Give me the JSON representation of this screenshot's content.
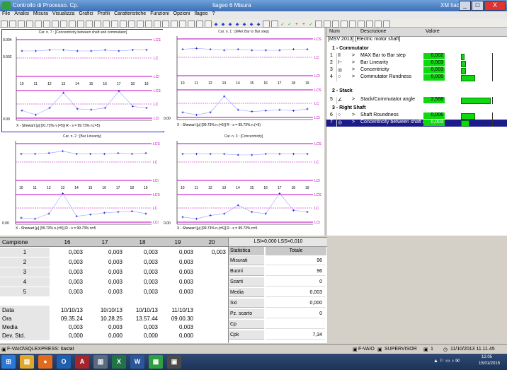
{
  "window": {
    "app_title": "Controllo di Processo. Cp.",
    "center_title": "Ilageo 6 Misura",
    "user": "XM ltaca",
    "min": "_",
    "max": "□",
    "close": "X"
  },
  "menu": [
    "File",
    "Analisi",
    "Misura",
    "Visualizza",
    "Grafici",
    "Profili",
    "Caratteristiche",
    "Funzioni",
    "Opzioni",
    "Ilageo",
    "?"
  ],
  "toolbar": {
    "icons": [
      "open-icon",
      "save-icon",
      "print-icon",
      "copy-icon",
      "paste-icon",
      "chart-icon",
      "table-icon",
      "grid-icon",
      "list-icon",
      "histogram-icon",
      "bars-icon",
      "calc-icon",
      "filter-icon",
      "zoom-icon",
      "settings-icon",
      "export-icon",
      "import-icon",
      "report-icon",
      "stats-icon",
      "sigma-icon",
      "db-icon",
      "lock-icon",
      "user-icon",
      "help-icon",
      "refresh-icon",
      "first-icon",
      "prev-icon",
      "play-icon",
      "next-icon",
      "last-icon",
      "rewind-icon",
      "forward-icon",
      "stop-icon",
      "record-icon",
      "check-icon",
      "check2-icon",
      "plus-icon",
      "minus-icon",
      "ok-icon",
      "cancel-icon",
      "warn-icon",
      "info-icon",
      "find-icon",
      "home-icon",
      "pin-icon",
      "tool-icon",
      "window-icon",
      "exit-icon"
    ]
  },
  "charts": [
    {
      "title": "Car. n. 7 : [Concentricity between shaft and commutator]",
      "y_top_labels": [
        "0.004",
        "0.002"
      ],
      "y_bottom_label": "0.00",
      "x_labels": [
        "10",
        "11",
        "12",
        "13",
        "14",
        "15",
        "16",
        "17",
        "18",
        "19"
      ],
      "limit_labels": [
        "LCS",
        "LC",
        "LCI"
      ],
      "legend": "X - Shewart [μ] [91.73% n.(=5)] R - s = 99.73% n.(=5)"
    },
    {
      "title": "Car. n. 1 : [MAX Bar to Bar step]",
      "y_top_labels": [],
      "y_bottom_label": "0.00",
      "x_labels": [
        "10",
        "11",
        "12",
        "13",
        "14",
        "15",
        "16",
        "17",
        "18",
        "19"
      ],
      "limit_labels": [
        "LCS",
        "LC",
        "LCI"
      ],
      "legend": "X - Shewart [μ] [99.73% n.(=5)] R - s = 99.73% n.(=5)"
    },
    {
      "title": "Car. n. 2 : [Bar Linearity]",
      "y_top_labels": [],
      "y_bottom_label": "0.00",
      "x_labels": [
        "10",
        "11",
        "12",
        "13",
        "14",
        "15",
        "16",
        "17",
        "18",
        "19"
      ],
      "limit_labels": [
        "LCS",
        "LC",
        "LCI"
      ],
      "legend": "X - Shewart [μ] [99.73% n.(=5)] R - s = 99.73% n=5"
    },
    {
      "title": "Car. n. 3 : [Concentricity]",
      "y_top_labels": [],
      "y_bottom_label": "0.00",
      "x_labels": [
        "10",
        "11",
        "12",
        "13",
        "14",
        "15",
        "16",
        "17",
        "18",
        "19"
      ],
      "limit_labels": [
        "LCS",
        "LC",
        "LCI"
      ],
      "legend": "X - Shewart [μ] [99.73% n.(=5)] R - s = 99.73% n=5"
    }
  ],
  "chart_data": [
    {
      "type": "line",
      "title": "Car. n. 7 : [Concentricity between shaft and commutator]",
      "x": [
        10,
        11,
        12,
        13,
        14,
        15,
        16,
        17,
        18,
        19
      ],
      "series": [
        {
          "values": [
            0.003,
            0.003,
            0.0031,
            0.0031,
            0.003,
            0.003,
            0.0031,
            0.003,
            0.0031,
            0.0031
          ]
        }
      ],
      "ylim": [
        0,
        0.0045
      ]
    },
    {
      "type": "line",
      "title": "Car. n. 1 : [MAX Bar to Bar step]",
      "x": [
        10,
        11,
        12,
        13,
        14,
        15,
        16,
        17,
        18,
        19
      ],
      "series": [
        {
          "values": [
            0.0031,
            0.0032,
            0.0031,
            0.003,
            0.0031,
            0.003,
            0.003,
            0.003,
            0.0031,
            0.0031
          ]
        }
      ],
      "ylim": [
        0,
        0.0045
      ]
    },
    {
      "type": "line",
      "title": "Car. n. 2 : [Bar Linearity]",
      "x": [
        10,
        11,
        12,
        13,
        14,
        15,
        16,
        17,
        18,
        19
      ],
      "series": [
        {
          "values": [
            0.0031,
            0.0031,
            0.0032,
            0.0034,
            0.0031,
            0.0031,
            0.0031,
            0.0032,
            0.0031,
            0.0032
          ]
        }
      ],
      "ylim": [
        0,
        0.0045
      ]
    },
    {
      "type": "line",
      "title": "Car. n. 3 : [Concentricity]",
      "x": [
        10,
        11,
        12,
        13,
        14,
        15,
        16,
        17,
        18,
        19
      ],
      "series": [
        {
          "values": [
            0.0031,
            0.0031,
            0.0031,
            0.0031,
            0.003,
            0.003,
            0.0031,
            0.0031,
            0.0031,
            0.0031
          ]
        }
      ],
      "ylim": [
        0,
        0.0045
      ]
    }
  ],
  "right_panel": {
    "headers": {
      "num": "Num",
      "desc": "Descrizione",
      "value": "Valore"
    },
    "part": "[MSV 2013] [Electric motor shaft]",
    "groups": [
      {
        "label": "1 - Commutator"
      },
      {
        "label": "2 - Stack"
      },
      {
        "label": "3 - Right Shaft"
      }
    ],
    "rows": [
      {
        "num": "1",
        "icon": "II",
        "arrow": ">",
        "desc": "MAX Bar to Bar step",
        "value": "0,002",
        "bar": 0.08
      },
      {
        "num": "2",
        "icon": "I~",
        "arrow": ">",
        "desc": "Bar Linearity",
        "value": "0,003",
        "bar": 0.12
      },
      {
        "num": "3",
        "icon": "◎",
        "arrow": ">",
        "desc": "Concentricity",
        "value": "0,003",
        "bar": 0.12
      },
      {
        "num": "4",
        "icon": "○",
        "arrow": ">",
        "desc": "Commutator Rundness",
        "value": "0,005",
        "bar": 0.45
      },
      {
        "num": "5",
        "icon": "∠",
        "arrow": ">",
        "desc": "Stack/Commutator angle",
        "value": "2,568",
        "bar": 1.0
      },
      {
        "num": "6",
        "icon": "○",
        "arrow": ">",
        "desc": "Shaft Roundness",
        "value": "0,006",
        "bar": 0.45
      },
      {
        "num": "7",
        "icon": "◎",
        "arrow": ">",
        "desc": "Concentricity between shaft a",
        "value": "0,003",
        "bar": 0.25
      }
    ]
  },
  "table": {
    "corner": "Campione",
    "columns": [
      "16",
      "17",
      "18",
      "19",
      "20"
    ],
    "rows": [
      {
        "label": "1",
        "values": [
          "0,003",
          "0,003",
          "0,003",
          "0,003",
          "0,003"
        ]
      },
      {
        "label": "2",
        "values": [
          "0,003",
          "0,003",
          "0,003",
          "0,003",
          ""
        ]
      },
      {
        "label": "3",
        "values": [
          "0,003",
          "0,003",
          "0,003",
          "0,003",
          ""
        ]
      },
      {
        "label": "4",
        "values": [
          "0,003",
          "0,003",
          "0,003",
          "0,003",
          ""
        ]
      },
      {
        "label": "5",
        "values": [
          "0,003",
          "0,003",
          "0,003",
          "0,003",
          ""
        ]
      }
    ],
    "info": [
      {
        "label": "Data",
        "values": [
          "10/10/13",
          "10/10/13",
          "10/10/13",
          "11/10/13",
          ""
        ]
      },
      {
        "label": "Ora",
        "values": [
          "09.35.24",
          "10.28.25",
          "13.57.44",
          "09.00.30",
          ""
        ]
      },
      {
        "label": "Media",
        "values": [
          "0,003",
          "0,003",
          "0,003",
          "0,003",
          ""
        ]
      },
      {
        "label": "Dev. Std.",
        "values": [
          "0,000",
          "0,000",
          "0,000",
          "0,000",
          ""
        ]
      }
    ]
  },
  "stats": {
    "limits": "LSI=0,000    LSS=0,010",
    "col_label": "Statistica",
    "col_total": "Totale",
    "rows": [
      {
        "label": "Misurati",
        "value": "96"
      },
      {
        "label": "Buoni",
        "value": "96"
      },
      {
        "label": "Scarti",
        "value": "0"
      },
      {
        "label": "Media",
        "value": "0,003"
      },
      {
        "label": "Sxi",
        "value": "0,000"
      },
      {
        "label": "Pz. scarto",
        "value": "0"
      },
      {
        "label": "Cp",
        "value": ""
      },
      {
        "label": "Cpk",
        "value": "7,34"
      }
    ]
  },
  "status": {
    "db": "F-VAIO\\SQLEXPRESS: itastat",
    "host": "F-VAIO",
    "role": "SUPERVISOR",
    "count": "1",
    "datetime": "11/10/2013 11.11.45"
  },
  "taskbar": {
    "time": "12.05",
    "date": "15/01/2015"
  }
}
